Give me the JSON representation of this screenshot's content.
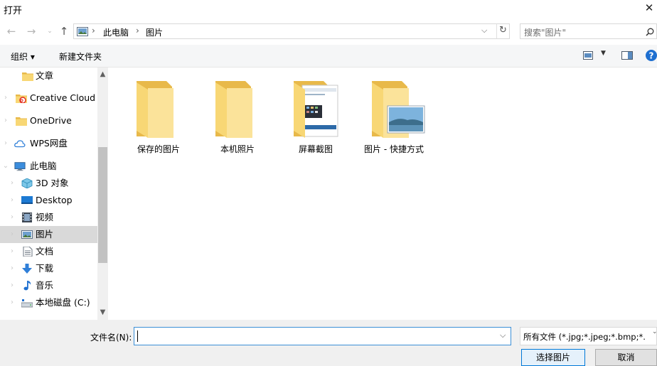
{
  "window": {
    "title": "打开"
  },
  "breadcrumb": [
    "此电脑",
    "图片"
  ],
  "search": {
    "placeholder": "搜索\"图片\""
  },
  "toolbar": {
    "organize_label": "组织 ▾",
    "new_folder_label": "新建文件夹"
  },
  "sidebar": {
    "items": [
      {
        "label": "文章",
        "icon": "folder-icon"
      },
      {
        "label": "Creative Cloud Files",
        "icon": "creative-cloud-icon"
      },
      {
        "label": "OneDrive",
        "icon": "folder-icon"
      },
      {
        "label": "WPS网盘",
        "icon": "cloud-icon"
      },
      {
        "label": "此电脑",
        "icon": "computer-icon"
      },
      {
        "label": "3D 对象",
        "icon": "cube-icon"
      },
      {
        "label": "Desktop",
        "icon": "desktop-icon"
      },
      {
        "label": "视频",
        "icon": "video-icon"
      },
      {
        "label": "图片",
        "icon": "pictures-icon",
        "selected": true
      },
      {
        "label": "文档",
        "icon": "document-icon"
      },
      {
        "label": "下载",
        "icon": "download-icon"
      },
      {
        "label": "音乐",
        "icon": "music-icon"
      },
      {
        "label": "本地磁盘 (C:)",
        "icon": "drive-icon"
      }
    ]
  },
  "files": [
    {
      "label": "保存的图片"
    },
    {
      "label": "本机照片"
    },
    {
      "label": "屏幕截图"
    },
    {
      "label": "图片 - 快捷方式"
    }
  ],
  "bottom": {
    "filename_label": "文件名(N):",
    "filename_value": "",
    "filetype_value": "所有文件 (*.jpg;*.jpeg;*.bmp;*.",
    "open_button": "选择图片",
    "cancel_button": "取消"
  },
  "colors": {
    "accent": "#0078d7",
    "folder": "#f8d775",
    "selection": "#d9d9d9"
  }
}
